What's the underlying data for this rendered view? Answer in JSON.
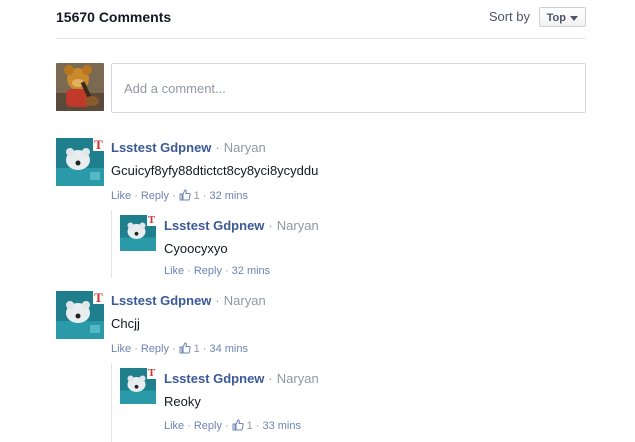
{
  "header": {
    "comment_count": "15670 Comments",
    "sort_label": "Sort by",
    "sort_value": "Top"
  },
  "composer": {
    "placeholder": "Add a comment..."
  },
  "comments": [
    {
      "author": "Lsstest Gdpnew",
      "location": "Naryan",
      "text": "Gcuicyf8yfy88dtictct8cy8yci8ycyddu",
      "like": "Like",
      "reply": "Reply",
      "likes_count": "1",
      "time": "32 mins",
      "replies": [
        {
          "author": "Lsstest Gdpnew",
          "location": "Naryan",
          "text": "Cyoocyxyo",
          "like": "Like",
          "reply": "Reply",
          "time": "32 mins"
        }
      ]
    },
    {
      "author": "Lsstest Gdpnew",
      "location": "Naryan",
      "text": "Chcjj",
      "like": "Like",
      "reply": "Reply",
      "likes_count": "1",
      "time": "34 mins",
      "replies": [
        {
          "author": "Lsstest Gdpnew",
          "location": "Naryan",
          "text": "Reoky",
          "like": "Like",
          "reply": "Reply",
          "likes_count": "1",
          "time": "33 mins"
        }
      ]
    }
  ],
  "colors": {
    "link": "#3b5998",
    "action": "#6d84b4",
    "muted": "#9197a3"
  },
  "icons": {
    "like": "thumbs-up-icon",
    "sort": "chevron-down-icon"
  }
}
